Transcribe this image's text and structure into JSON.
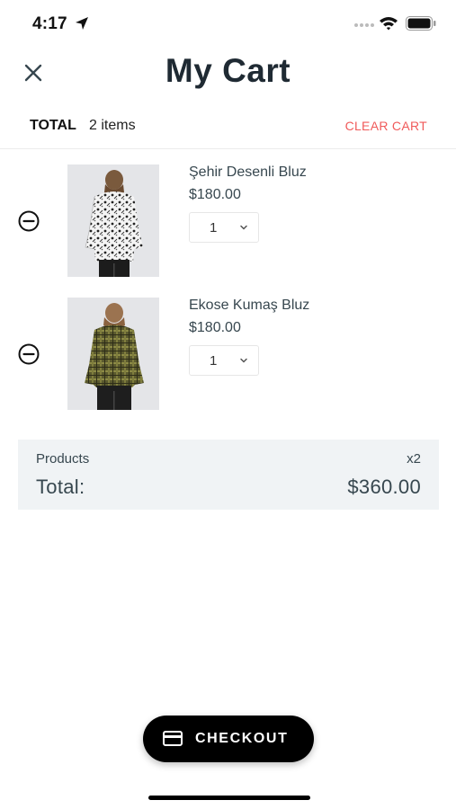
{
  "status_bar": {
    "time": "4:17"
  },
  "header": {
    "title": "My Cart"
  },
  "summary": {
    "total_label": "TOTAL",
    "items_count": "2 items",
    "clear_label": "CLEAR CART"
  },
  "items": [
    {
      "name": "Şehir Desenli Bluz",
      "price": "$180.00",
      "quantity": "1"
    },
    {
      "name": "Ekose Kumaş Bluz",
      "price": "$180.00",
      "quantity": "1"
    }
  ],
  "totals": {
    "products_label": "Products",
    "products_count": "x2",
    "total_label": "Total:",
    "total_amount": "$360.00"
  },
  "checkout": {
    "label": "CHECKOUT"
  },
  "colors": {
    "accent_red": "#f05a5a",
    "text_dark": "#37474f",
    "totals_bg": "#f0f3f5",
    "button_bg": "#000000"
  }
}
